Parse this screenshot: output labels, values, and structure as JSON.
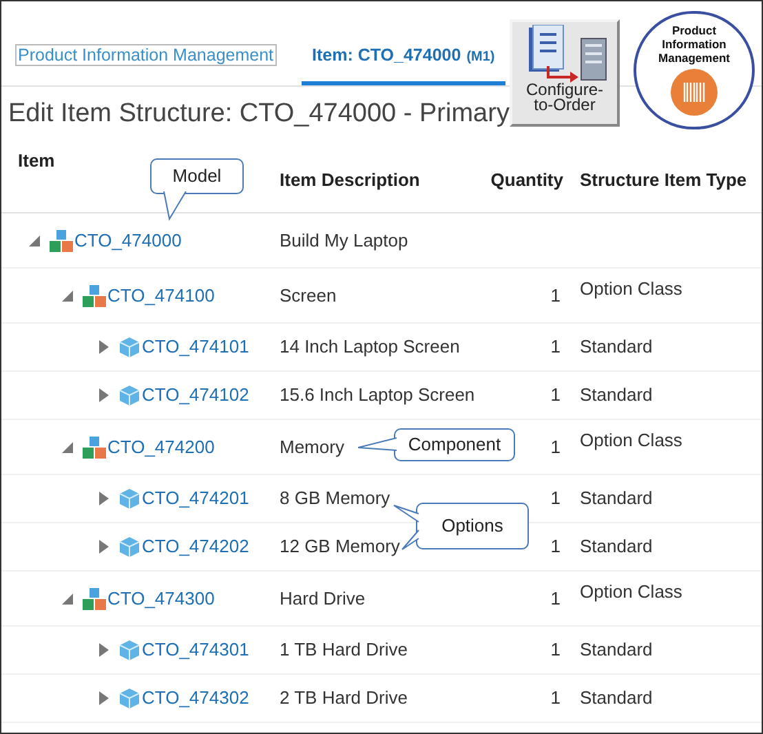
{
  "tabs": [
    {
      "label": "Product Information Management",
      "selected": false
    },
    {
      "label": "Item: CTO_474000",
      "badge": "(M1)",
      "selected": true
    }
  ],
  "app_tiles": [
    {
      "kind": "cto",
      "label": "Configure-to-Order"
    },
    {
      "kind": "pim",
      "label": "Product Information Management"
    }
  ],
  "page_title": "Edit Item Structure: CTO_474000 - Primary",
  "table": {
    "columns": [
      "Item",
      "Item Description",
      "Quantity",
      "Structure Item Type"
    ],
    "rows": [
      {
        "item": "CTO_474000",
        "kind": "model",
        "description": "Build My Laptop",
        "expanded": true,
        "children": [
          {
            "item": "CTO_474100",
            "kind": "model",
            "description": "Screen",
            "quantity": "1",
            "type": "Option Class",
            "expanded": true,
            "children": [
              {
                "item": "CTO_474101",
                "kind": "standard",
                "description": "14 Inch Laptop Screen",
                "quantity": "1",
                "type": "Standard",
                "expanded": false
              },
              {
                "item": "CTO_474102",
                "kind": "standard",
                "description": "15.6 Inch Laptop Screen",
                "quantity": "1",
                "type": "Standard",
                "expanded": false
              }
            ]
          },
          {
            "item": "CTO_474200",
            "kind": "model",
            "description": "Memory",
            "quantity": "1",
            "type": "Option Class",
            "expanded": true,
            "children": [
              {
                "item": "CTO_474201",
                "kind": "standard",
                "description": "8 GB Memory",
                "quantity": "1",
                "type": "Standard",
                "expanded": false
              },
              {
                "item": "CTO_474202",
                "kind": "standard",
                "description": "12 GB Memory",
                "quantity": "1",
                "type": "Standard",
                "expanded": false
              }
            ]
          },
          {
            "item": "CTO_474300",
            "kind": "model",
            "description": "Hard Drive",
            "quantity": "1",
            "type": "Option Class",
            "expanded": true,
            "children": [
              {
                "item": "CTO_474301",
                "kind": "standard",
                "description": "1 TB Hard Drive",
                "quantity": "1",
                "type": "Standard",
                "expanded": false
              },
              {
                "item": "CTO_474302",
                "kind": "standard",
                "description": "2 TB Hard Drive",
                "quantity": "1",
                "type": "Standard",
                "expanded": false
              }
            ]
          }
        ]
      }
    ]
  },
  "callouts": [
    {
      "text": "Model"
    },
    {
      "text": "Component"
    },
    {
      "text": "Options"
    }
  ]
}
